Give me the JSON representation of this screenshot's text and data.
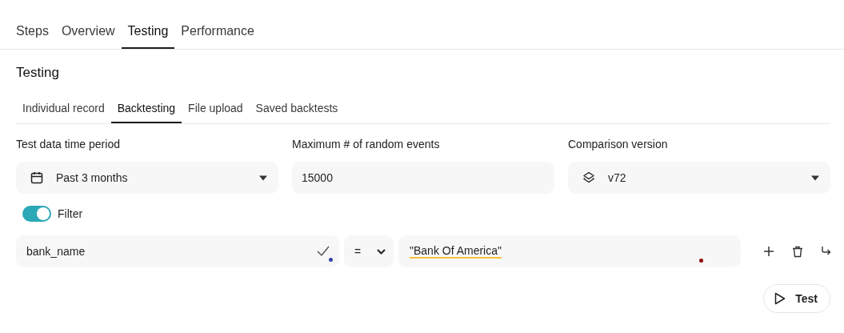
{
  "tabs": [
    {
      "label": "Steps",
      "selected": false
    },
    {
      "label": "Overview",
      "selected": false
    },
    {
      "label": "Testing",
      "selected": true
    },
    {
      "label": "Performance",
      "selected": false
    }
  ],
  "section_title": "Testing",
  "subtabs": [
    {
      "label": "Individual record",
      "selected": false
    },
    {
      "label": "Backtesting",
      "selected": true
    },
    {
      "label": "File upload",
      "selected": false
    },
    {
      "label": "Saved backtests",
      "selected": false
    }
  ],
  "fields": [
    {
      "kind": "select",
      "label": "Test data time period",
      "value": "Past 3 months"
    },
    {
      "kind": "input",
      "label": "Maximum # of random events",
      "value": "15000"
    },
    {
      "kind": "select",
      "label": "Comparison version",
      "value": "v72"
    }
  ],
  "filter": {
    "label": "Filter",
    "on": true,
    "field": "bank_name",
    "operator": "=",
    "value": "\"Bank Of America\""
  },
  "test_button": "Test"
}
